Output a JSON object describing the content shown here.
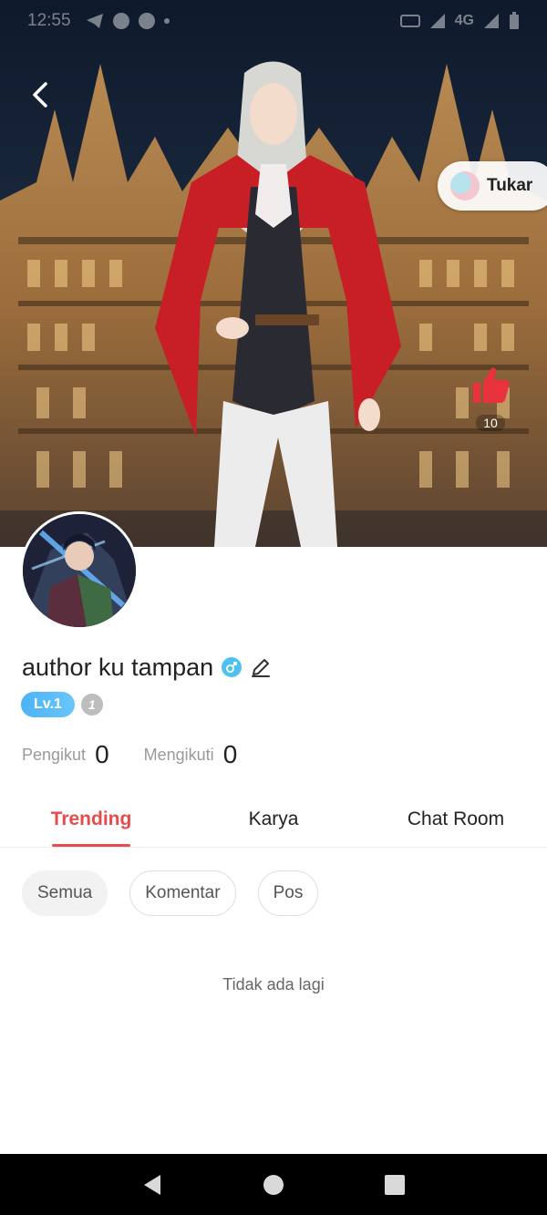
{
  "status_bar": {
    "time": "12:55",
    "network": "4G"
  },
  "header": {
    "back_icon": "chevron-left-icon",
    "switch_button_label": "Tukar",
    "like_icon": "thumbs-up-icon",
    "like_count": "10"
  },
  "profile": {
    "username": "author ku tampan",
    "gender_icon": "male-icon",
    "level_badge": "Lv.1",
    "info_badge": "1",
    "followers_label": "Pengikut",
    "followers_count": "0",
    "following_label": "Mengikuti",
    "following_count": "0"
  },
  "tabs": [
    {
      "label": "Trending",
      "active": true
    },
    {
      "label": "Karya",
      "active": false
    },
    {
      "label": "Chat Room",
      "active": false
    }
  ],
  "filters": [
    {
      "label": "Semua",
      "selected": true
    },
    {
      "label": "Komentar",
      "selected": false
    },
    {
      "label": "Pos",
      "selected": false
    }
  ],
  "empty_message": "Tidak ada lagi",
  "colors": {
    "accent": "#e74b4b",
    "level_blue": "#4cb3f5",
    "like_red": "#e8323c"
  }
}
